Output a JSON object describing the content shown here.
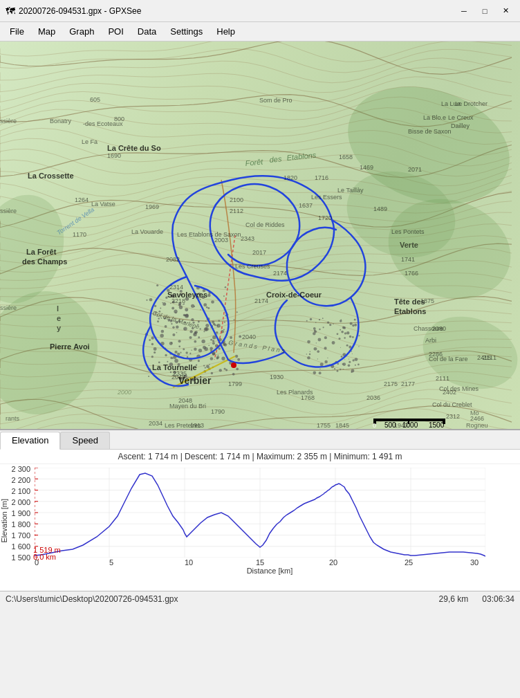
{
  "titlebar": {
    "title": "20200726-094531.gpx - GPXSee",
    "minimize_label": "─",
    "maximize_label": "□",
    "close_label": "✕"
  },
  "menubar": {
    "items": [
      {
        "id": "file",
        "label": "File"
      },
      {
        "id": "map",
        "label": "Map"
      },
      {
        "id": "graph",
        "label": "Graph"
      },
      {
        "id": "poi",
        "label": "POI"
      },
      {
        "id": "data",
        "label": "Data"
      },
      {
        "id": "settings",
        "label": "Settings"
      },
      {
        "id": "help",
        "label": "Help"
      }
    ]
  },
  "graph": {
    "tabs": [
      {
        "id": "elevation",
        "label": "Elevation",
        "active": true
      },
      {
        "id": "speed",
        "label": "Speed",
        "active": false
      }
    ],
    "stats": "Ascent: 1 714 m  |  Descent: 1 714 m  |  Maximum: 2 355 m  |  Minimum: 1 491 m",
    "y_axis_label": "Elevation [m]",
    "x_axis_label": "Distance [km]",
    "y_min": 1500,
    "y_max": 2300,
    "x_max": 30,
    "marker_elevation": "1 519 m",
    "marker_distance": "0,0 km",
    "y_ticks": [
      1500,
      1600,
      1700,
      1800,
      1900,
      2000,
      2100,
      2200,
      2300
    ],
    "x_ticks": [
      0,
      5,
      10,
      15,
      20,
      25,
      30
    ]
  },
  "statusbar": {
    "path": "C:\\Users\\tumic\\Desktop\\20200726-094531.gpx",
    "distance": "29,6 km",
    "time": "03:06:34"
  },
  "map": {
    "places": [
      "La Crête du So",
      "Savoleyres",
      "Croix-de-Coeur",
      "Pierre Avoi",
      "La Tournelle",
      "Verbier",
      "Tête des Etablons",
      "La Crossette",
      "La Forêt",
      "des Champs",
      "Forêt"
    ]
  }
}
